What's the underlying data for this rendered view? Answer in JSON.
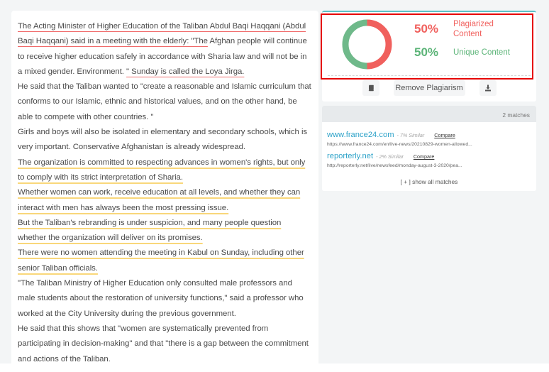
{
  "document": {
    "segments": [
      {
        "text": "The Acting Minister of Higher Education of the Taliban Abdul Baqi Haqqani (Abdul Baqi Haqqani) said in a meeting with the elderly: \"The",
        "style": "plag-red",
        "break_after": false
      },
      {
        "text": " Afghan people will continue to receive higher education safely in accordance with Sharia law and will not be in a mixed gender. Environment. ",
        "style": "plain",
        "break_after": false
      },
      {
        "text": "\" Sunday is called the Loya Jirga.",
        "style": "plag-red",
        "break_after": true
      },
      {
        "text": " He said that the Taliban wanted to \"create a reasonable and Islamic curriculum that conforms to our Islamic, ethnic and historical values, and on the other hand, be able to compete with other countries. \"",
        "style": "plain",
        "break_after": true
      },
      {
        "text": " Girls and boys will also be isolated in elementary and secondary schools, which is very important. Conservative Afghanistan is already widespread.",
        "style": "plain",
        "break_after": false
      },
      {
        "text": " ",
        "style": "plag-yellow",
        "break_after": true
      },
      {
        "text": " The organization is committed to respecting advances in women's rights, but only to comply with its strict interpretation of Sharia.",
        "style": "plag-yellow",
        "break_after": true
      },
      {
        "text": " Whether women can work, receive education at all levels, and whether they can interact with men has always been the most pressing issue.",
        "style": "plag-yellow",
        "break_after": true
      },
      {
        "text": " But the Taliban's rebranding is under suspicion, and many people question whether the organization will deliver on its promises.",
        "style": "plag-yellow",
        "break_after": true
      },
      {
        "text": " There were no women attending the meeting in Kabul on Sunday, including other senior Taliban officials.",
        "style": "plag-yellow",
        "break_after": true
      },
      {
        "text": " \"The Taliban Ministry of Higher Education only consulted male professors and male students about the restoration of university functions,\" said a professor who worked at the City University during the previous government.",
        "style": "plain",
        "break_after": true
      },
      {
        "text": " He said that this shows that \"women are systematically prevented from participating in decision-making\" and that \"there is a gap between the commitment and actions of the Taliban.",
        "style": "plain",
        "break_after": false
      },
      {
        "text": " ",
        "style": "plag-yellow",
        "break_after": false
      }
    ]
  },
  "score": {
    "plagiarized_percent": "50%",
    "plagiarized_label": "Plagiarized Content",
    "unique_percent": "50%",
    "unique_label": "Unique Content",
    "plagiarized_fraction": 0.5,
    "colors": {
      "plagiarized": "#f0605d",
      "unique": "#6fb98a",
      "highlight_border": "#e60000",
      "accent_top": "#5bc0c6"
    }
  },
  "actions": {
    "book_icon": "book-icon",
    "remove_label": "Remove Plagiarism",
    "download_icon": "download-icon"
  },
  "matches": {
    "count_label": "2 matches",
    "items": [
      {
        "domain": "www.france24.com",
        "similarity": "- 7% Similar",
        "compare_label": "Compare",
        "url": "https://www.france24.com/en/live-news/20210829-women-allowed..."
      },
      {
        "domain": "reporterly.net",
        "similarity": "- 2% Similar",
        "compare_label": "Compare",
        "url": "http://reporterly.net/live/newsfeed/monday-august-3-2020/pea..."
      }
    ],
    "show_all_label": "[ + ] show all matches"
  }
}
